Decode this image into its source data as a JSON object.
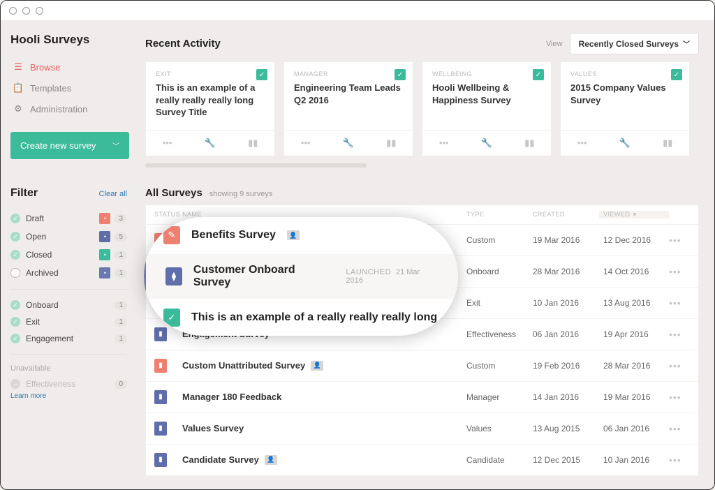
{
  "app_title": "Hooli Surveys",
  "nav": {
    "browse": "Browse",
    "templates": "Templates",
    "administration": "Administration"
  },
  "create_button": "Create new survey",
  "filter": {
    "title": "Filter",
    "clear": "Clear all",
    "statuses": [
      {
        "label": "Draft",
        "count": "3",
        "badge_color": "mb-coral"
      },
      {
        "label": "Open",
        "count": "5",
        "badge_color": "mb-blue"
      },
      {
        "label": "Closed",
        "count": "1",
        "badge_color": "mb-teal"
      },
      {
        "label": "Archived",
        "count": "1",
        "badge_color": "mb-indigo",
        "unchecked": true
      }
    ],
    "types": [
      {
        "label": "Onboard",
        "count": "1"
      },
      {
        "label": "Exit",
        "count": "1"
      },
      {
        "label": "Engagement",
        "count": "1"
      }
    ],
    "unavailable_label": "Unavailable",
    "unavailable_item": "Effectiveness",
    "unavailable_count": "0",
    "learn_more": "Learn more"
  },
  "recent": {
    "title": "Recent Activity",
    "view_label": "View",
    "view_value": "Recently Closed Surveys",
    "cards": [
      {
        "category": "EXIT",
        "name": "This is an example of a really really really long Survey Title"
      },
      {
        "category": "MANAGER",
        "name": "Engineering Team Leads Q2 2016"
      },
      {
        "category": "WELLBEING",
        "name": "Hooli Wellbeing & Happiness Survey"
      },
      {
        "category": "VALUES",
        "name": "2015 Company Values Survey"
      }
    ]
  },
  "all": {
    "title": "All Surveys",
    "showing": "showing 9 surveys",
    "columns": {
      "status": "STATUS",
      "name": "NAME",
      "type": "TYPE",
      "created": "CREATED",
      "viewed": "VIEWED"
    },
    "rows": [
      {
        "name": "Benefits Survey",
        "type": "Custom",
        "created": "19 Mar 2016",
        "viewed": "12 Dec 2016",
        "status_color": "mb-coral",
        "person": true
      },
      {
        "name": "Customer Onboard Survey",
        "type": "Onboard",
        "created": "28 Mar 2016",
        "viewed": "14 Oct 2016",
        "status_color": "mb-blue"
      },
      {
        "name": "This is an example of a really really really long",
        "type": "Exit",
        "created": "10 Jan 2016",
        "viewed": "13 Aug 2016",
        "status_color": "mb-teal"
      },
      {
        "name": "Engagement Survey",
        "type": "Effectiveness",
        "created": "06 Jan 2016",
        "viewed": "19 Apr 2016",
        "status_color": "mb-blue"
      },
      {
        "name": "Custom Unattributed Survey",
        "type": "Custom",
        "created": "19 Feb 2016",
        "viewed": "28 Mar 2016",
        "status_color": "mb-coral",
        "person": true
      },
      {
        "name": "Manager 180 Feedback",
        "type": "Manager",
        "created": "14 Jan 2016",
        "viewed": "19 Mar 2016",
        "status_color": "mb-blue"
      },
      {
        "name": "Values Survey",
        "type": "Values",
        "created": "13 Aug 2015",
        "viewed": "06 Jan 2016",
        "status_color": "mb-blue"
      },
      {
        "name": "Candidate Survey",
        "type": "Candidate",
        "created": "12 Dec 2015",
        "viewed": "10 Jan 2016",
        "status_color": "mb-blue",
        "person": true
      }
    ]
  },
  "lens": {
    "row0_name": "Benefits Survey",
    "row1_name": "Customer Onboard Survey",
    "row1_launched_label": "LAUNCHED",
    "row1_launched_date": "21 Mar 2016",
    "row2_name": "This is an example of a really really really long"
  }
}
